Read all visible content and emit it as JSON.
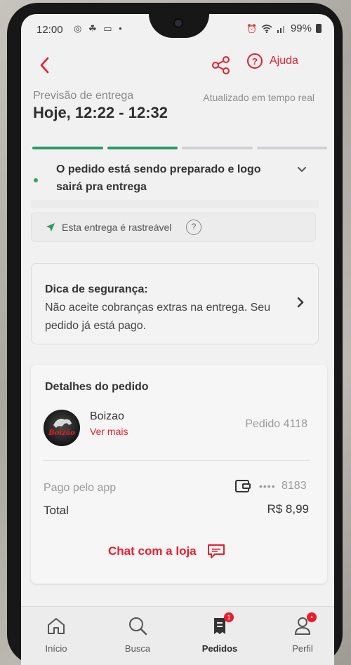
{
  "status_bar": {
    "time": "12:00",
    "notification_icons": "◎ ☘ ▭ •",
    "battery": "99%"
  },
  "header": {
    "help_label": "Ajuda"
  },
  "delivery": {
    "eta_label": "Previsão de entrega",
    "eta_value": "Hoje, 12:22 - 12:32",
    "updated_text": "Atualizado em tempo real",
    "status_text": "O pedido está sendo preparado e logo sairá pra entrega",
    "progress_steps_done": 2,
    "progress_steps_total": 4
  },
  "tracking": {
    "text": "Esta entrega é rastreável"
  },
  "safety_tip": {
    "title": "Dica de segurança:",
    "body": "Não aceite cobranças extras na entrega. Seu pedido já está pago."
  },
  "order": {
    "section_title": "Detalhes do pedido",
    "store_name": "Boizao",
    "store_logo_text": "Boizão",
    "see_more": "Ver mais",
    "order_number": "Pedido 4118",
    "payment_label": "Pago pelo app",
    "card_mask": "••••",
    "card_last_digits": "8183",
    "total_label": "Total",
    "total_value": "R$ 8,99",
    "chat_label": "Chat com a loja"
  },
  "bottom_nav": {
    "items": [
      {
        "label": "Início",
        "icon": "home-icon",
        "active": false
      },
      {
        "label": "Busca",
        "icon": "search-icon",
        "active": false
      },
      {
        "label": "Pedidos",
        "icon": "orders-icon",
        "active": true,
        "badge": "1"
      },
      {
        "label": "Perfil",
        "icon": "profile-icon",
        "active": false,
        "badge": "•"
      }
    ]
  },
  "colors": {
    "brand_red": "#ea1d2c",
    "progress_done": "#2f9a66",
    "progress_todo": "#cfd1d4",
    "status_dot": "#3b9b63"
  }
}
